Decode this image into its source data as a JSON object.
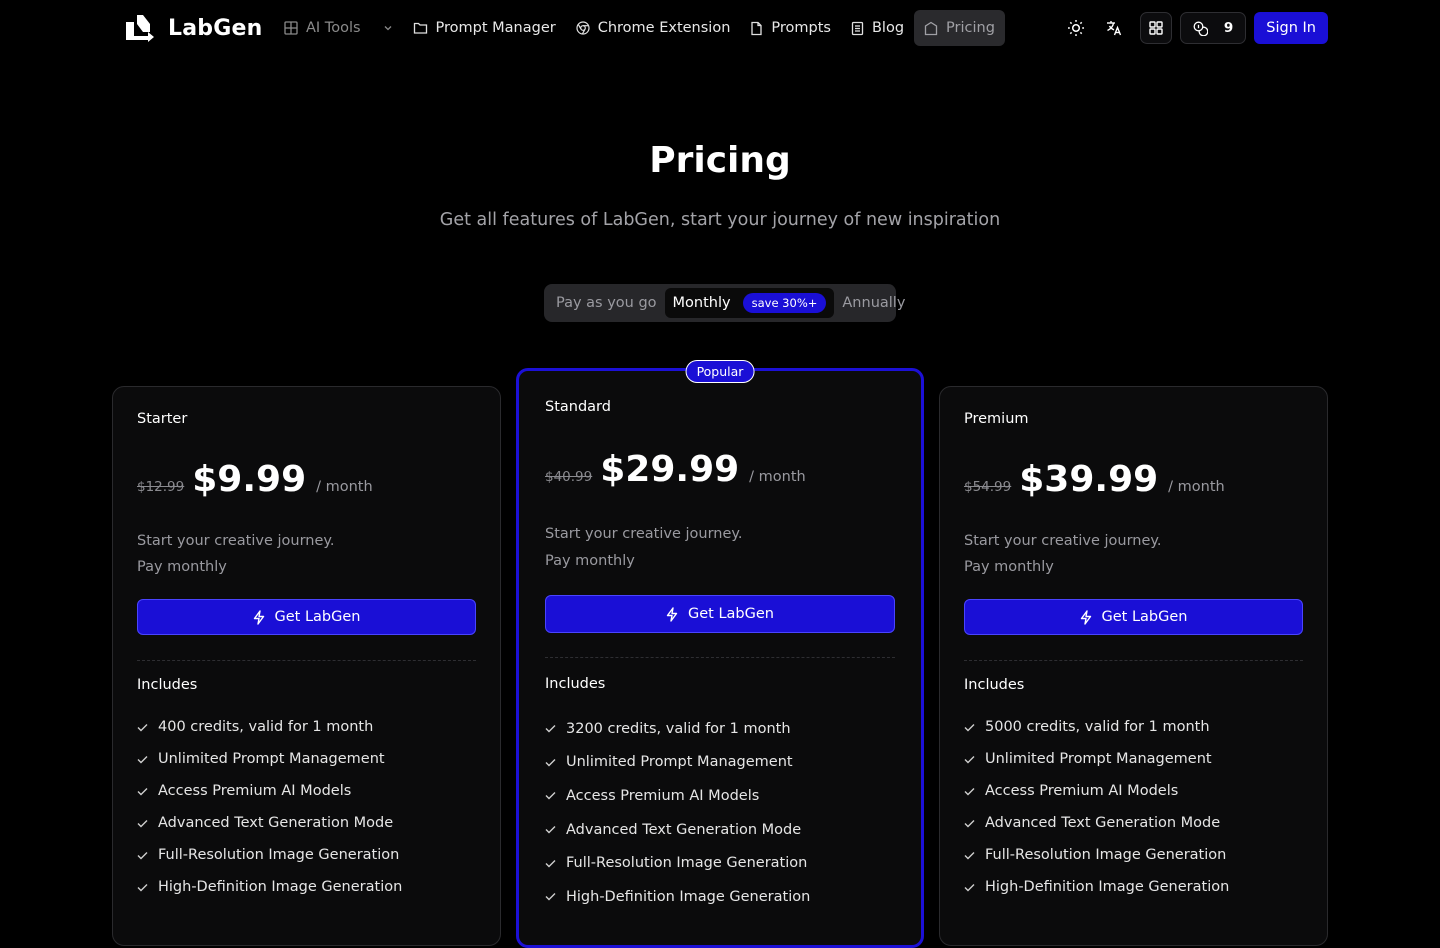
{
  "nav": {
    "logo_text": "LabGen",
    "ai_tools": "AI Tools",
    "prompt_manager": "Prompt Manager",
    "chrome_extension": "Chrome Extension",
    "prompts": "Prompts",
    "blog": "Blog",
    "pricing": "Pricing",
    "credits": "9",
    "sign_in": "Sign In"
  },
  "hero": {
    "title": "Pricing",
    "subtitle": "Get all features of LabGen, start your journey of new inspiration"
  },
  "billing_toggle": {
    "pay_as_you_go": "Pay as you go",
    "monthly": "Monthly",
    "save_badge": "save 30%+",
    "annually": "Annually",
    "selected": "Monthly"
  },
  "plans": [
    {
      "name": "Starter",
      "old_price": "$12.99",
      "price": "$9.99",
      "period": "/ month",
      "desc_line1": "Start your creative journey.",
      "desc_line2": "Pay monthly",
      "cta": "Get LabGen",
      "includes": "Includes",
      "features": [
        "400 credits, valid for 1 month",
        "Unlimited Prompt Management",
        "Access Premium AI Models",
        "Advanced Text Generation Mode",
        "Full-Resolution Image Generation",
        "High-Definition Image Generation"
      ]
    },
    {
      "name": "Standard",
      "badge": "Popular",
      "old_price": "$40.99",
      "price": "$29.99",
      "period": "/ month",
      "desc_line1": "Start your creative journey.",
      "desc_line2": "Pay monthly",
      "cta": "Get LabGen",
      "includes": "Includes",
      "features": [
        "3200 credits, valid for 1 month",
        "Unlimited Prompt Management",
        "Access Premium AI Models",
        "Advanced Text Generation Mode",
        "Full-Resolution Image Generation",
        "High-Definition Image Generation"
      ]
    },
    {
      "name": "Premium",
      "old_price": "$54.99",
      "price": "$39.99",
      "period": "/ month",
      "desc_line1": "Start your creative journey.",
      "desc_line2": "Pay monthly",
      "cta": "Get LabGen",
      "includes": "Includes",
      "features": [
        "5000 credits, valid for 1 month",
        "Unlimited Prompt Management",
        "Access Premium AI Models",
        "Advanced Text Generation Mode",
        "Full-Resolution Image Generation",
        "High-Definition Image Generation"
      ]
    }
  ],
  "colors": {
    "accent": "#1a0fd6",
    "background": "#000000",
    "card": "#0b0b0c"
  }
}
